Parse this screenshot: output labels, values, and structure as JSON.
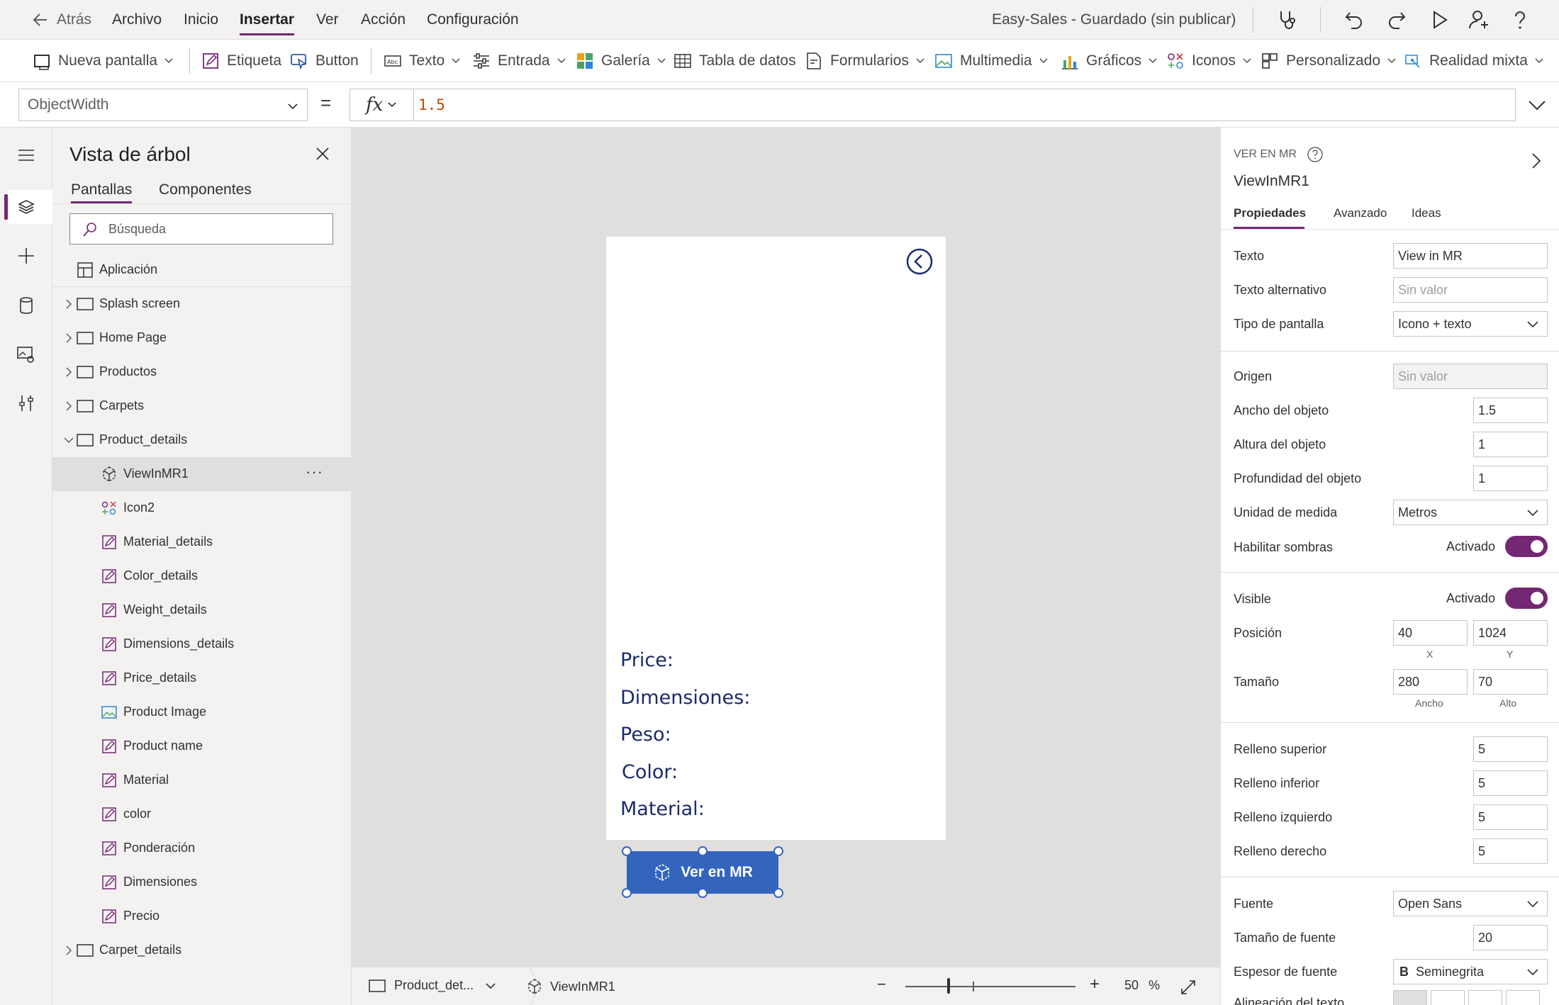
{
  "menu": {
    "back": "Atrás",
    "items": [
      "Archivo",
      "Inicio",
      "Insertar",
      "Ver",
      "Acción",
      "Configuración"
    ],
    "active": "Insertar",
    "app_status": "Easy-Sales - Guardado (sin publicar)"
  },
  "toolbar": {
    "new_screen": "Nueva pantalla",
    "label": "Etiqueta",
    "button": "Button",
    "text": "Texto",
    "input": "Entrada",
    "gallery": "Galería",
    "data_table": "Tabla de datos",
    "forms": "Formularios",
    "media": "Multimedia",
    "charts": "Gráficos",
    "icons": "Iconos",
    "custom": "Personalizado",
    "mixed_reality": "Realidad mixta"
  },
  "formula": {
    "property": "ObjectWidth",
    "equals": "=",
    "fx": "fx",
    "value": "1.5"
  },
  "tree": {
    "title": "Vista de árbol",
    "tabs": [
      "Pantallas",
      "Componentes"
    ],
    "search_placeholder": "Búsqueda",
    "app_label": "Aplicación",
    "screens": [
      "Splash screen",
      "Home Page",
      "Productos",
      "Carpets",
      "Product_details"
    ],
    "children": [
      "ViewInMR1",
      "Icon2",
      "Material_details",
      "Color_details",
      "Weight_details",
      "Dimensions_details",
      "Price_details",
      "Product Image",
      "Product name",
      "Material",
      "color",
      "Ponderación",
      "Dimensiones",
      "Precio"
    ],
    "last_screen": "Carpet_details",
    "more": "···"
  },
  "canvas": {
    "labels": [
      "Price:",
      "Dimensiones:",
      "Peso:",
      "Color:",
      "Material:"
    ],
    "button_text": "Ver en MR"
  },
  "status": {
    "screen": "Product_det...",
    "control": "ViewInMR1",
    "zoom_minus": "−",
    "zoom_plus": "+",
    "zoom_value": "50",
    "zoom_unit": "%"
  },
  "props": {
    "kind": "VER EN MR",
    "name": "ViewInMR1",
    "tabs": [
      "Propiedades",
      "Avanzado",
      "Ideas"
    ],
    "text_label": "Texto",
    "text_value": "View in MR",
    "alt_label": "Texto alternativo",
    "alt_value": "Sin valor",
    "display_label": "Tipo de pantalla",
    "display_value": "Icono + texto",
    "source_label": "Origen",
    "source_value": "Sin valor",
    "width_label": "Ancho del objeto",
    "width_value": "1.5",
    "height_label": "Altura del objeto",
    "height_value": "1",
    "depth_label": "Profundidad del objeto",
    "depth_value": "1",
    "unit_label": "Unidad de medida",
    "unit_value": "Metros",
    "shadows_label": "Habilitar sombras",
    "shadows_state": "Activado",
    "visible_label": "Visible",
    "visible_state": "Activado",
    "position_label": "Posición",
    "pos_x": "40",
    "pos_y": "1024",
    "pos_x_lbl": "X",
    "pos_y_lbl": "Y",
    "size_label": "Tamaño",
    "size_w": "280",
    "size_h": "70",
    "size_w_lbl": "Ancho",
    "size_h_lbl": "Alto",
    "pad_top_label": "Relleno superior",
    "pad_top": "5",
    "pad_bottom_label": "Relleno inferior",
    "pad_bottom": "5",
    "pad_left_label": "Relleno izquierdo",
    "pad_left": "5",
    "pad_right_label": "Relleno derecho",
    "pad_right": "5",
    "font_label": "Fuente",
    "font_value": "Open Sans",
    "font_size_label": "Tamaño de fuente",
    "font_size_value": "20",
    "font_weight_label": "Espesor de fuente",
    "font_weight_value": "Seminegrita",
    "font_weight_icon": "B",
    "align_label": "Alineación del texto"
  },
  "colors": {
    "accent": "#742774",
    "button": "#3465bd",
    "canvas_text": "#1b2a6b",
    "formula_value": "#c04b00"
  }
}
